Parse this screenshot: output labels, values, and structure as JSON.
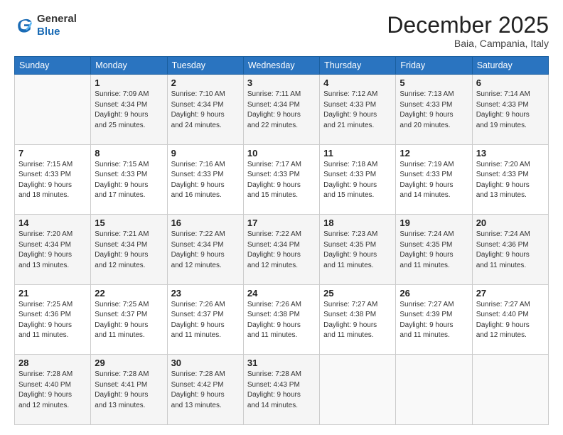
{
  "header": {
    "logo_general": "General",
    "logo_blue": "Blue",
    "month": "December 2025",
    "location": "Baia, Campania, Italy"
  },
  "days_of_week": [
    "Sunday",
    "Monday",
    "Tuesday",
    "Wednesday",
    "Thursday",
    "Friday",
    "Saturday"
  ],
  "weeks": [
    [
      {
        "day": "",
        "info": ""
      },
      {
        "day": "1",
        "info": "Sunrise: 7:09 AM\nSunset: 4:34 PM\nDaylight: 9 hours\nand 25 minutes."
      },
      {
        "day": "2",
        "info": "Sunrise: 7:10 AM\nSunset: 4:34 PM\nDaylight: 9 hours\nand 24 minutes."
      },
      {
        "day": "3",
        "info": "Sunrise: 7:11 AM\nSunset: 4:34 PM\nDaylight: 9 hours\nand 22 minutes."
      },
      {
        "day": "4",
        "info": "Sunrise: 7:12 AM\nSunset: 4:33 PM\nDaylight: 9 hours\nand 21 minutes."
      },
      {
        "day": "5",
        "info": "Sunrise: 7:13 AM\nSunset: 4:33 PM\nDaylight: 9 hours\nand 20 minutes."
      },
      {
        "day": "6",
        "info": "Sunrise: 7:14 AM\nSunset: 4:33 PM\nDaylight: 9 hours\nand 19 minutes."
      }
    ],
    [
      {
        "day": "7",
        "info": "Sunrise: 7:15 AM\nSunset: 4:33 PM\nDaylight: 9 hours\nand 18 minutes."
      },
      {
        "day": "8",
        "info": "Sunrise: 7:15 AM\nSunset: 4:33 PM\nDaylight: 9 hours\nand 17 minutes."
      },
      {
        "day": "9",
        "info": "Sunrise: 7:16 AM\nSunset: 4:33 PM\nDaylight: 9 hours\nand 16 minutes."
      },
      {
        "day": "10",
        "info": "Sunrise: 7:17 AM\nSunset: 4:33 PM\nDaylight: 9 hours\nand 15 minutes."
      },
      {
        "day": "11",
        "info": "Sunrise: 7:18 AM\nSunset: 4:33 PM\nDaylight: 9 hours\nand 15 minutes."
      },
      {
        "day": "12",
        "info": "Sunrise: 7:19 AM\nSunset: 4:33 PM\nDaylight: 9 hours\nand 14 minutes."
      },
      {
        "day": "13",
        "info": "Sunrise: 7:20 AM\nSunset: 4:33 PM\nDaylight: 9 hours\nand 13 minutes."
      }
    ],
    [
      {
        "day": "14",
        "info": "Sunrise: 7:20 AM\nSunset: 4:34 PM\nDaylight: 9 hours\nand 13 minutes."
      },
      {
        "day": "15",
        "info": "Sunrise: 7:21 AM\nSunset: 4:34 PM\nDaylight: 9 hours\nand 12 minutes."
      },
      {
        "day": "16",
        "info": "Sunrise: 7:22 AM\nSunset: 4:34 PM\nDaylight: 9 hours\nand 12 minutes."
      },
      {
        "day": "17",
        "info": "Sunrise: 7:22 AM\nSunset: 4:34 PM\nDaylight: 9 hours\nand 12 minutes."
      },
      {
        "day": "18",
        "info": "Sunrise: 7:23 AM\nSunset: 4:35 PM\nDaylight: 9 hours\nand 11 minutes."
      },
      {
        "day": "19",
        "info": "Sunrise: 7:24 AM\nSunset: 4:35 PM\nDaylight: 9 hours\nand 11 minutes."
      },
      {
        "day": "20",
        "info": "Sunrise: 7:24 AM\nSunset: 4:36 PM\nDaylight: 9 hours\nand 11 minutes."
      }
    ],
    [
      {
        "day": "21",
        "info": "Sunrise: 7:25 AM\nSunset: 4:36 PM\nDaylight: 9 hours\nand 11 minutes."
      },
      {
        "day": "22",
        "info": "Sunrise: 7:25 AM\nSunset: 4:37 PM\nDaylight: 9 hours\nand 11 minutes."
      },
      {
        "day": "23",
        "info": "Sunrise: 7:26 AM\nSunset: 4:37 PM\nDaylight: 9 hours\nand 11 minutes."
      },
      {
        "day": "24",
        "info": "Sunrise: 7:26 AM\nSunset: 4:38 PM\nDaylight: 9 hours\nand 11 minutes."
      },
      {
        "day": "25",
        "info": "Sunrise: 7:27 AM\nSunset: 4:38 PM\nDaylight: 9 hours\nand 11 minutes."
      },
      {
        "day": "26",
        "info": "Sunrise: 7:27 AM\nSunset: 4:39 PM\nDaylight: 9 hours\nand 11 minutes."
      },
      {
        "day": "27",
        "info": "Sunrise: 7:27 AM\nSunset: 4:40 PM\nDaylight: 9 hours\nand 12 minutes."
      }
    ],
    [
      {
        "day": "28",
        "info": "Sunrise: 7:28 AM\nSunset: 4:40 PM\nDaylight: 9 hours\nand 12 minutes."
      },
      {
        "day": "29",
        "info": "Sunrise: 7:28 AM\nSunset: 4:41 PM\nDaylight: 9 hours\nand 13 minutes."
      },
      {
        "day": "30",
        "info": "Sunrise: 7:28 AM\nSunset: 4:42 PM\nDaylight: 9 hours\nand 13 minutes."
      },
      {
        "day": "31",
        "info": "Sunrise: 7:28 AM\nSunset: 4:43 PM\nDaylight: 9 hours\nand 14 minutes."
      },
      {
        "day": "",
        "info": ""
      },
      {
        "day": "",
        "info": ""
      },
      {
        "day": "",
        "info": ""
      }
    ]
  ]
}
